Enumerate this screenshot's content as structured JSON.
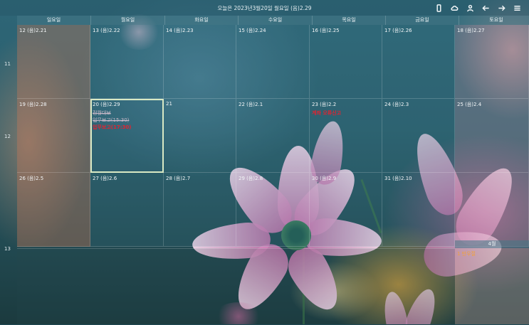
{
  "topbar": {
    "title": "오늘은 2023년3월20일 월요일 (음)2.29",
    "icons": [
      "phone-icon",
      "cloud-icon",
      "user-icon",
      "arrow-left-icon",
      "arrow-right-icon",
      "menu-icon"
    ]
  },
  "days": [
    "일요일",
    "월요일",
    "화요일",
    "수요일",
    "목요일",
    "금요일",
    "토요일"
  ],
  "week_numbers": [
    "11",
    "12",
    "13"
  ],
  "weeks": [
    [
      {
        "date": "12 (음)2.21",
        "kind": "sun"
      },
      {
        "date": "13 (음)2.22"
      },
      {
        "date": "14 (음)2.23"
      },
      {
        "date": "15 (음)2.24"
      },
      {
        "date": "16 (음)2.25"
      },
      {
        "date": "17 (음)2.26"
      },
      {
        "date": "18 (음)2.27",
        "kind": "sat"
      }
    ],
    [
      {
        "date": "19 (음)2.28",
        "kind": "sun"
      },
      {
        "date": "20 (음)2.29",
        "today": true,
        "events": [
          {
            "text": "정월대보",
            "style": "done"
          },
          {
            "text": "업무보고(15:30)",
            "style": "done"
          },
          {
            "text": "업무보고(17:30)",
            "style": "red"
          }
        ]
      },
      {
        "date": "21"
      },
      {
        "date": "22 (음)2.1"
      },
      {
        "date": "23 (음)2.2",
        "events": [
          {
            "text": "계좌 오류신고",
            "style": "red"
          }
        ]
      },
      {
        "date": "24 (음)2.3"
      },
      {
        "date": "25 (음)2.4",
        "kind": "sat"
      }
    ],
    [
      {
        "date": "26 (음)2.5",
        "kind": "sun"
      },
      {
        "date": "27 (음)2.6"
      },
      {
        "date": "28 (음)2.7"
      },
      {
        "date": "29 (음)2.8"
      },
      {
        "date": "30 (음)2.9"
      },
      {
        "date": "31 (음)2.10"
      },
      {
        "date": "",
        "kind": "sat"
      }
    ]
  ],
  "next_month": {
    "label": "4월",
    "first_day": "1 만우절"
  }
}
